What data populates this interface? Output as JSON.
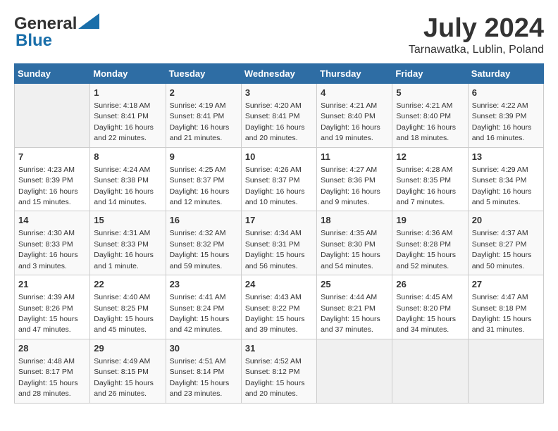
{
  "header": {
    "logo_line1": "General",
    "logo_line2": "Blue",
    "title": "July 2024",
    "subtitle": "Tarnawatka, Lublin, Poland"
  },
  "columns": [
    "Sunday",
    "Monday",
    "Tuesday",
    "Wednesday",
    "Thursday",
    "Friday",
    "Saturday"
  ],
  "weeks": [
    [
      {
        "day": "",
        "detail": ""
      },
      {
        "day": "1",
        "detail": "Sunrise: 4:18 AM\nSunset: 8:41 PM\nDaylight: 16 hours\nand 22 minutes."
      },
      {
        "day": "2",
        "detail": "Sunrise: 4:19 AM\nSunset: 8:41 PM\nDaylight: 16 hours\nand 21 minutes."
      },
      {
        "day": "3",
        "detail": "Sunrise: 4:20 AM\nSunset: 8:41 PM\nDaylight: 16 hours\nand 20 minutes."
      },
      {
        "day": "4",
        "detail": "Sunrise: 4:21 AM\nSunset: 8:40 PM\nDaylight: 16 hours\nand 19 minutes."
      },
      {
        "day": "5",
        "detail": "Sunrise: 4:21 AM\nSunset: 8:40 PM\nDaylight: 16 hours\nand 18 minutes."
      },
      {
        "day": "6",
        "detail": "Sunrise: 4:22 AM\nSunset: 8:39 PM\nDaylight: 16 hours\nand 16 minutes."
      }
    ],
    [
      {
        "day": "7",
        "detail": "Sunrise: 4:23 AM\nSunset: 8:39 PM\nDaylight: 16 hours\nand 15 minutes."
      },
      {
        "day": "8",
        "detail": "Sunrise: 4:24 AM\nSunset: 8:38 PM\nDaylight: 16 hours\nand 14 minutes."
      },
      {
        "day": "9",
        "detail": "Sunrise: 4:25 AM\nSunset: 8:37 PM\nDaylight: 16 hours\nand 12 minutes."
      },
      {
        "day": "10",
        "detail": "Sunrise: 4:26 AM\nSunset: 8:37 PM\nDaylight: 16 hours\nand 10 minutes."
      },
      {
        "day": "11",
        "detail": "Sunrise: 4:27 AM\nSunset: 8:36 PM\nDaylight: 16 hours\nand 9 minutes."
      },
      {
        "day": "12",
        "detail": "Sunrise: 4:28 AM\nSunset: 8:35 PM\nDaylight: 16 hours\nand 7 minutes."
      },
      {
        "day": "13",
        "detail": "Sunrise: 4:29 AM\nSunset: 8:34 PM\nDaylight: 16 hours\nand 5 minutes."
      }
    ],
    [
      {
        "day": "14",
        "detail": "Sunrise: 4:30 AM\nSunset: 8:33 PM\nDaylight: 16 hours\nand 3 minutes."
      },
      {
        "day": "15",
        "detail": "Sunrise: 4:31 AM\nSunset: 8:33 PM\nDaylight: 16 hours\nand 1 minute."
      },
      {
        "day": "16",
        "detail": "Sunrise: 4:32 AM\nSunset: 8:32 PM\nDaylight: 15 hours\nand 59 minutes."
      },
      {
        "day": "17",
        "detail": "Sunrise: 4:34 AM\nSunset: 8:31 PM\nDaylight: 15 hours\nand 56 minutes."
      },
      {
        "day": "18",
        "detail": "Sunrise: 4:35 AM\nSunset: 8:30 PM\nDaylight: 15 hours\nand 54 minutes."
      },
      {
        "day": "19",
        "detail": "Sunrise: 4:36 AM\nSunset: 8:28 PM\nDaylight: 15 hours\nand 52 minutes."
      },
      {
        "day": "20",
        "detail": "Sunrise: 4:37 AM\nSunset: 8:27 PM\nDaylight: 15 hours\nand 50 minutes."
      }
    ],
    [
      {
        "day": "21",
        "detail": "Sunrise: 4:39 AM\nSunset: 8:26 PM\nDaylight: 15 hours\nand 47 minutes."
      },
      {
        "day": "22",
        "detail": "Sunrise: 4:40 AM\nSunset: 8:25 PM\nDaylight: 15 hours\nand 45 minutes."
      },
      {
        "day": "23",
        "detail": "Sunrise: 4:41 AM\nSunset: 8:24 PM\nDaylight: 15 hours\nand 42 minutes."
      },
      {
        "day": "24",
        "detail": "Sunrise: 4:43 AM\nSunset: 8:22 PM\nDaylight: 15 hours\nand 39 minutes."
      },
      {
        "day": "25",
        "detail": "Sunrise: 4:44 AM\nSunset: 8:21 PM\nDaylight: 15 hours\nand 37 minutes."
      },
      {
        "day": "26",
        "detail": "Sunrise: 4:45 AM\nSunset: 8:20 PM\nDaylight: 15 hours\nand 34 minutes."
      },
      {
        "day": "27",
        "detail": "Sunrise: 4:47 AM\nSunset: 8:18 PM\nDaylight: 15 hours\nand 31 minutes."
      }
    ],
    [
      {
        "day": "28",
        "detail": "Sunrise: 4:48 AM\nSunset: 8:17 PM\nDaylight: 15 hours\nand 28 minutes."
      },
      {
        "day": "29",
        "detail": "Sunrise: 4:49 AM\nSunset: 8:15 PM\nDaylight: 15 hours\nand 26 minutes."
      },
      {
        "day": "30",
        "detail": "Sunrise: 4:51 AM\nSunset: 8:14 PM\nDaylight: 15 hours\nand 23 minutes."
      },
      {
        "day": "31",
        "detail": "Sunrise: 4:52 AM\nSunset: 8:12 PM\nDaylight: 15 hours\nand 20 minutes."
      },
      {
        "day": "",
        "detail": ""
      },
      {
        "day": "",
        "detail": ""
      },
      {
        "day": "",
        "detail": ""
      }
    ]
  ]
}
